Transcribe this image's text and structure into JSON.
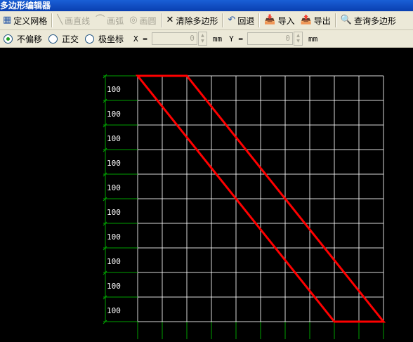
{
  "window": {
    "title": "多边形编辑器"
  },
  "toolbar": {
    "define_grid": "定义网格",
    "draw_line": "画直线",
    "draw_arc": "画弧",
    "draw_circle": "画圆",
    "clear_polygon": "清除多边形",
    "undo": "回退",
    "import": "导入",
    "export": "导出",
    "query_polygon": "查询多边形"
  },
  "options": {
    "no_offset": "不偏移",
    "orthogonal": "正交",
    "polar": "极坐标",
    "selected": "不偏移",
    "x_label": "X =",
    "x_value": "0",
    "x_unit": "mm",
    "y_label": "Y =",
    "y_value": "0",
    "y_unit": "mm"
  },
  "grid": {
    "row_labels": [
      "100",
      "100",
      "100",
      "100",
      "100",
      "100",
      "100",
      "100",
      "100",
      "100"
    ],
    "columns": 10,
    "rows": 10,
    "polygon_vertices": [
      [
        0,
        0
      ],
      [
        2,
        0
      ],
      [
        10,
        10
      ],
      [
        8,
        10
      ]
    ],
    "colors": {
      "grid": "#ffffff",
      "polygon": "#ff0000",
      "axis": "#00a000"
    }
  }
}
